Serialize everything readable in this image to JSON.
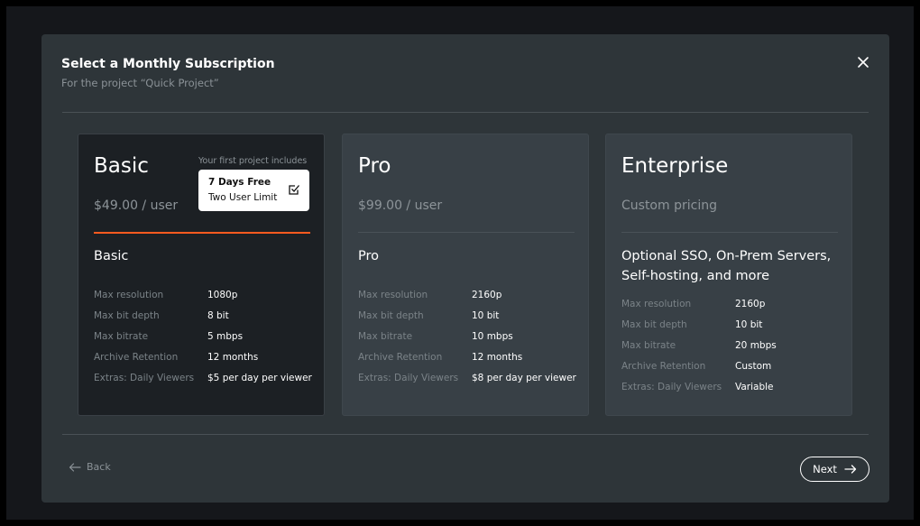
{
  "modal": {
    "title": "Select a Monthly Subscription",
    "subtitle": "For the project “Quick Project”",
    "close_icon": "close-icon"
  },
  "plans": [
    {
      "name": "Basic",
      "price": "$49.00 / user",
      "description": "Basic",
      "selected": true,
      "promo": {
        "caption": "Your first project includes",
        "line1": "7 Days Free",
        "line2": "Two User Limit",
        "icon": "checkbox-checked-icon"
      },
      "specs": [
        {
          "label": "Max resolution",
          "value": "1080p"
        },
        {
          "label": "Max bit depth",
          "value": "8 bit"
        },
        {
          "label": "Max bitrate",
          "value": "5 mbps"
        },
        {
          "label": "Archive Retention",
          "value": "12 months"
        },
        {
          "label": "Extras: Daily Viewers",
          "value": "$5 per day per viewer"
        }
      ]
    },
    {
      "name": "Pro",
      "price": "$99.00 / user",
      "description": "Pro",
      "selected": false,
      "specs": [
        {
          "label": "Max resolution",
          "value": "2160p"
        },
        {
          "label": "Max bit depth",
          "value": "10 bit"
        },
        {
          "label": "Max bitrate",
          "value": "10 mbps"
        },
        {
          "label": "Archive Retention",
          "value": "12 months"
        },
        {
          "label": "Extras: Daily Viewers",
          "value": "$8 per day per viewer"
        }
      ]
    },
    {
      "name": "Enterprise",
      "price": "Custom pricing",
      "description": "Optional SSO, On-Prem Servers, Self-hosting, and more",
      "selected": false,
      "specs": [
        {
          "label": "Max resolution",
          "value": "2160p"
        },
        {
          "label": "Max bit depth",
          "value": "10 bit"
        },
        {
          "label": "Max bitrate",
          "value": "20 mbps"
        },
        {
          "label": "Archive Retention",
          "value": "Custom"
        },
        {
          "label": "Extras: Daily Viewers",
          "value": "Variable"
        }
      ]
    }
  ],
  "footer": {
    "back_label": "Back",
    "next_label": "Next",
    "back_icon": "arrow-left-icon",
    "next_icon": "arrow-right-icon"
  },
  "colors": {
    "accent": "#ff5a1f",
    "modal_bg": "#2e3539",
    "card_bg": "#384046",
    "selected_card_bg": "#1c2024"
  }
}
